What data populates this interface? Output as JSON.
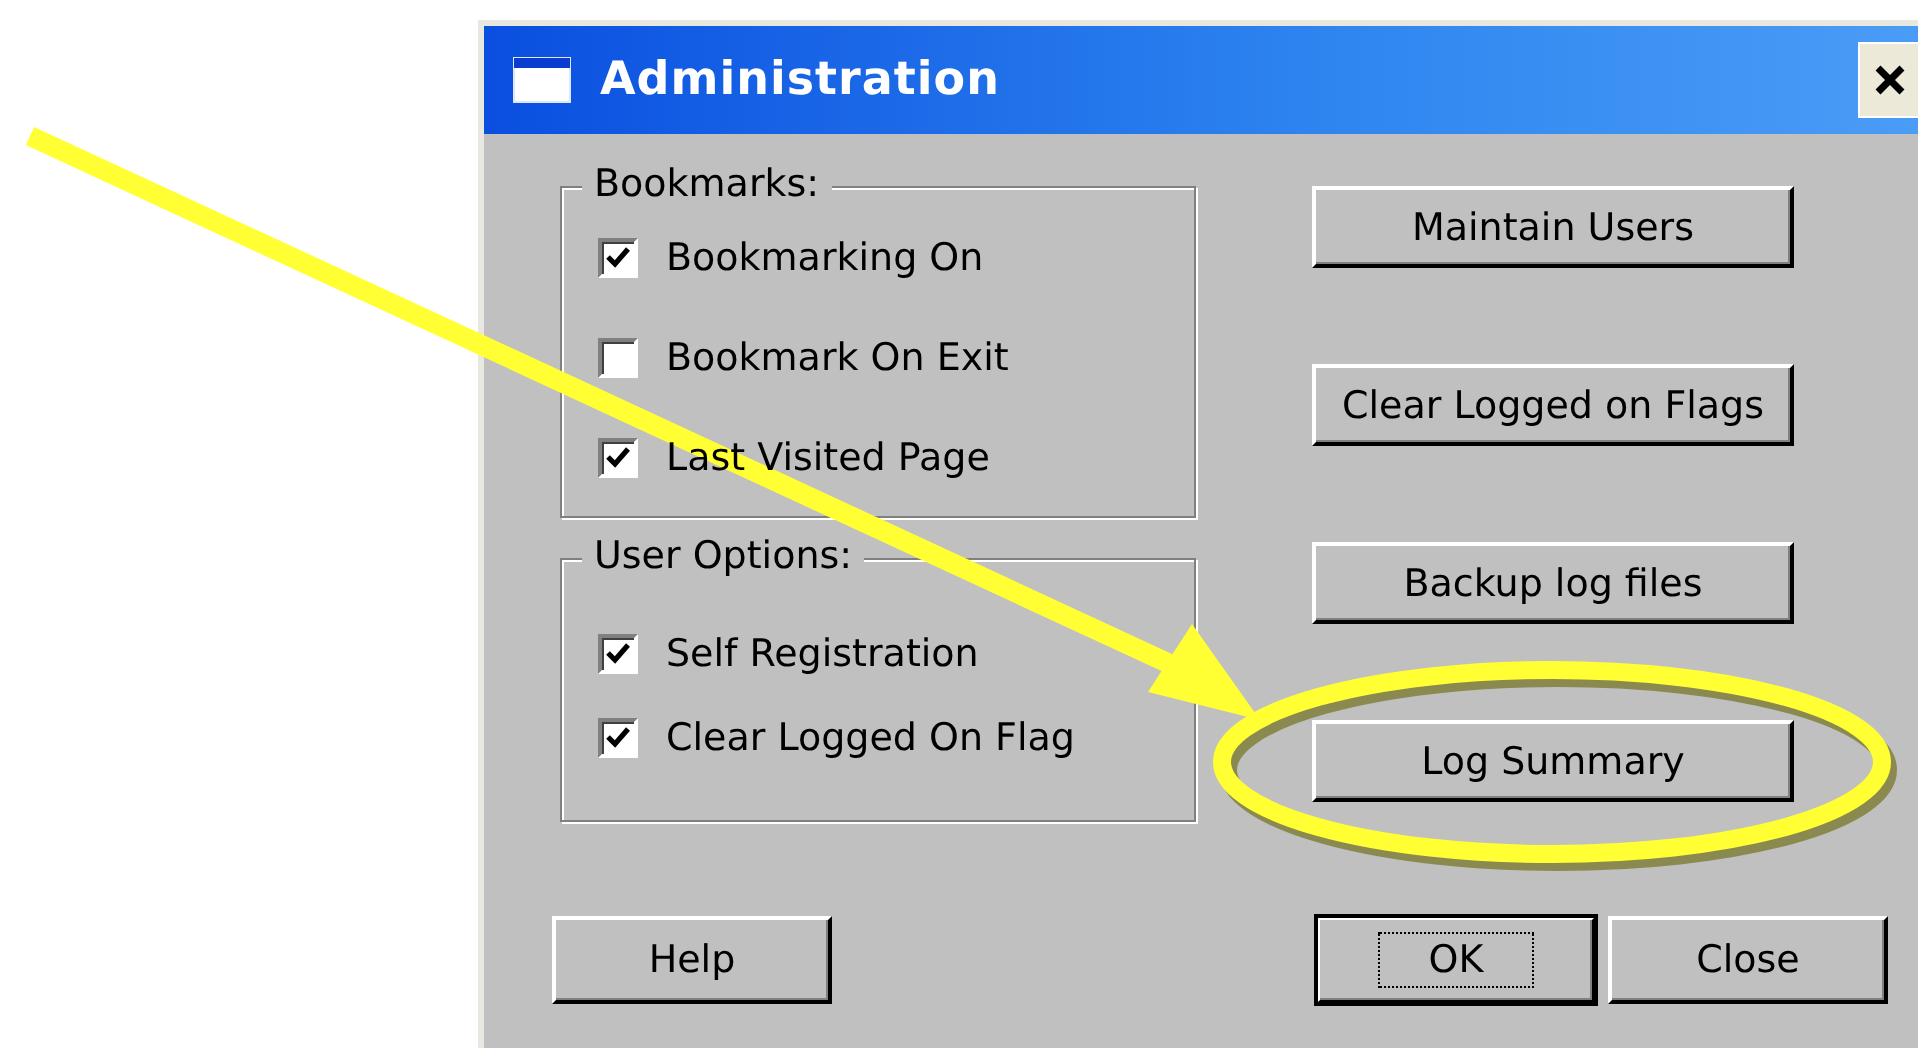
{
  "window": {
    "title": "Administration"
  },
  "groups": [
    {
      "title": "Bookmarks:",
      "options": [
        {
          "label": "Bookmarking On",
          "checked": true
        },
        {
          "label": "Bookmark On Exit",
          "checked": false
        },
        {
          "label": "Last Visited Page",
          "checked": true
        }
      ]
    },
    {
      "title": "User Options:",
      "options": [
        {
          "label": "Self Registration",
          "checked": true
        },
        {
          "label": "Clear Logged On Flag",
          "checked": true
        }
      ]
    }
  ],
  "action_buttons": [
    {
      "label": "Maintain Users",
      "highlighted": false
    },
    {
      "label": "Clear Logged on Flags",
      "highlighted": false
    },
    {
      "label": "Backup log files",
      "highlighted": false
    },
    {
      "label": "Log Summary",
      "highlighted": true
    }
  ],
  "footer_buttons": [
    {
      "label": "Help",
      "default": false
    },
    {
      "label": "OK",
      "default": true
    },
    {
      "label": "Close",
      "default": false
    }
  ]
}
